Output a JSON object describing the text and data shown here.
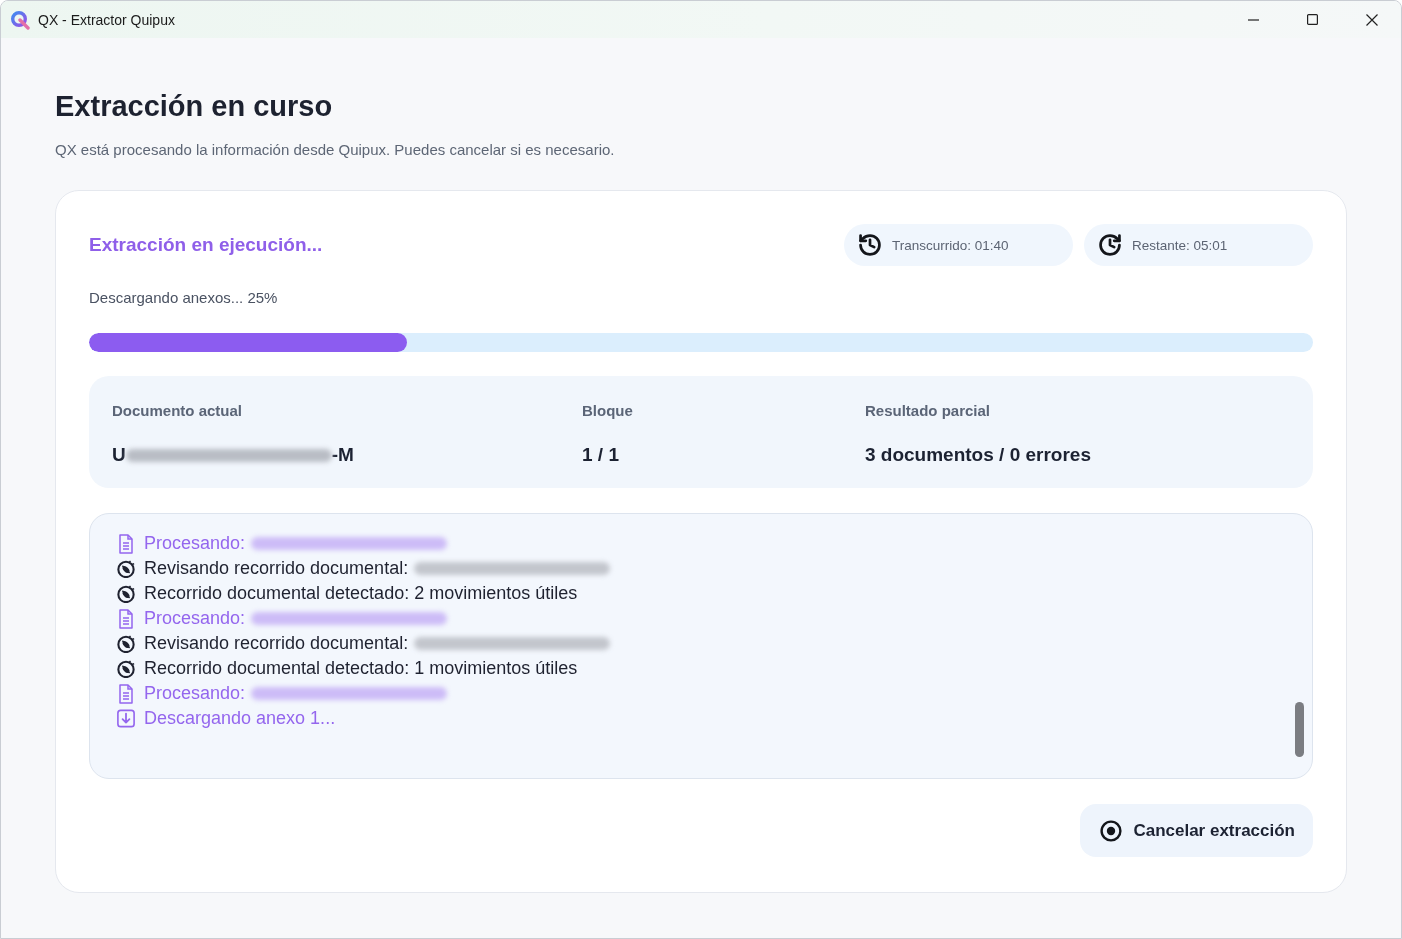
{
  "window": {
    "title": "QX - Extractor Quipux"
  },
  "header": {
    "title": "Extracción en curso",
    "subtitle": "QX está procesando la información desde Quipux. Puedes cancelar si es necesario."
  },
  "progress_card": {
    "status_title": "Extracción en ejecución...",
    "timers": [
      {
        "kind": "elapsed",
        "label": "Transcurrido: 01:40"
      },
      {
        "kind": "remaining",
        "label": "Restante: 05:01"
      }
    ],
    "progress": {
      "label": "Descargando anexos... 25%",
      "level": 0.26
    },
    "details": [
      {
        "label": "Documento actual",
        "value": "U",
        "redacted": true,
        "value_end": "-M"
      },
      {
        "label": "Bloque",
        "value": "1 / 1",
        "redacted": false
      },
      {
        "label": "Resultado parcial",
        "value": "3 documentos / 0 errores",
        "redacted": false
      }
    ],
    "log": {
      "entries": [
        {
          "kind": "processing",
          "text": "Procesando:",
          "redacted": true
        },
        {
          "kind": "review",
          "text": "Revisando recorrido documental:",
          "redacted": true
        },
        {
          "kind": "detected",
          "text": "Recorrido documental detectado: 2 movimientos útiles",
          "redacted": false
        },
        {
          "kind": "processing",
          "text": "Procesando:",
          "redacted": true
        },
        {
          "kind": "review",
          "text": "Revisando recorrido documental:",
          "redacted": true
        },
        {
          "kind": "detected",
          "text": "Recorrido documental detectado: 1 movimientos útiles",
          "redacted": false
        },
        {
          "kind": "processing",
          "text": "Procesando:",
          "redacted": true
        },
        {
          "kind": "download",
          "text": "Descargando anexo 1...",
          "redacted": false
        }
      ]
    },
    "cancel_button": {
      "label": "Cancelar extracción"
    }
  }
}
